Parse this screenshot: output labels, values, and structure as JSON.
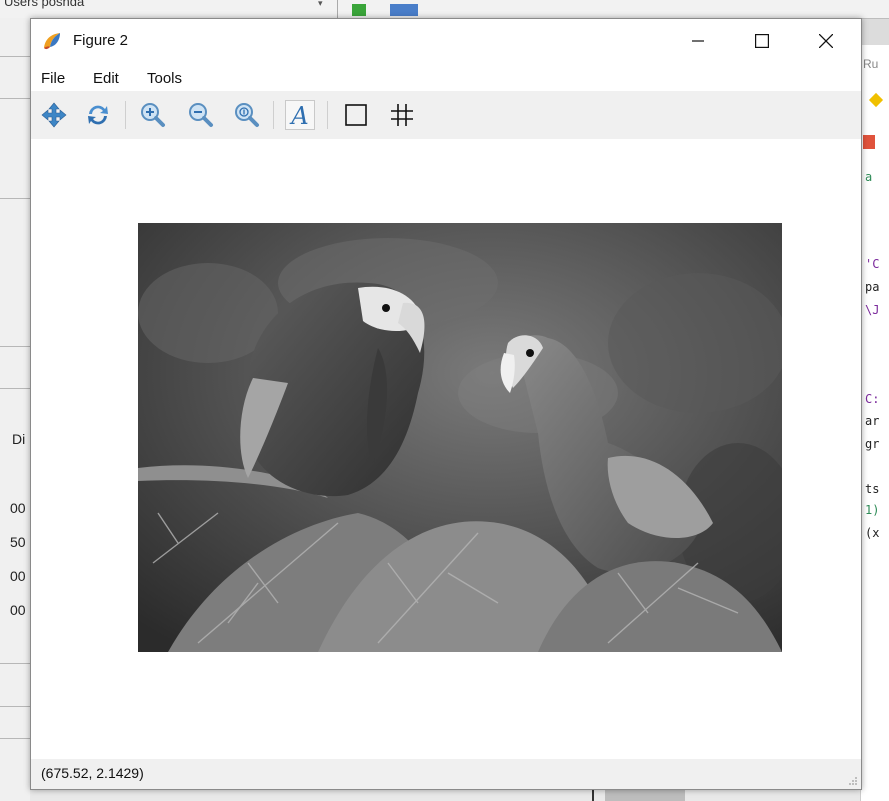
{
  "background": {
    "path_text": "Users posnda",
    "left_panel_texts": [
      "Di",
      "00",
      "50",
      "00",
      "00"
    ],
    "right_code_lines": [
      {
        "text": "a",
        "color": "#2e8b57"
      },
      {
        "text": "'C",
        "color": "#7b2a9c"
      },
      {
        "text": "pa",
        "color": "#222222"
      },
      {
        "text": "\\J",
        "color": "#7b2a9c"
      },
      {
        "text": "C:",
        "color": "#7b2a9c"
      },
      {
        "text": "ar",
        "color": "#222222"
      },
      {
        "text": "gr",
        "color": "#222222"
      },
      {
        "text": "ts",
        "color": "#222222"
      },
      {
        "text": "1)",
        "color": "#2e8b57"
      },
      {
        "text": "(x",
        "color": "#222222"
      }
    ],
    "right_tab_text": "Ru"
  },
  "window": {
    "title": "Figure 2",
    "menu": [
      "File",
      "Edit",
      "Tools"
    ],
    "toolbar": [
      {
        "icon": "pan-icon",
        "tooltip": "Pan"
      },
      {
        "icon": "reset-view-icon",
        "tooltip": "Reset"
      },
      {
        "icon": "zoom-in-icon",
        "tooltip": "Zoom in"
      },
      {
        "icon": "zoom-out-icon",
        "tooltip": "Zoom out"
      },
      {
        "icon": "zoom-actual-icon",
        "tooltip": "Zoom 1:1"
      },
      {
        "icon": "text-font-icon",
        "tooltip": "Text"
      },
      {
        "icon": "box-icon",
        "tooltip": "Box"
      },
      {
        "icon": "grid-icon",
        "tooltip": "Grid"
      }
    ],
    "status": "(675.52, 2.1429)"
  },
  "image": {
    "subject": "grayscale photo of two macaws perched on fern branches",
    "colors": {
      "dark": "#2a2a2a",
      "mid": "#6b6b6b",
      "light": "#bdbdbd"
    }
  }
}
